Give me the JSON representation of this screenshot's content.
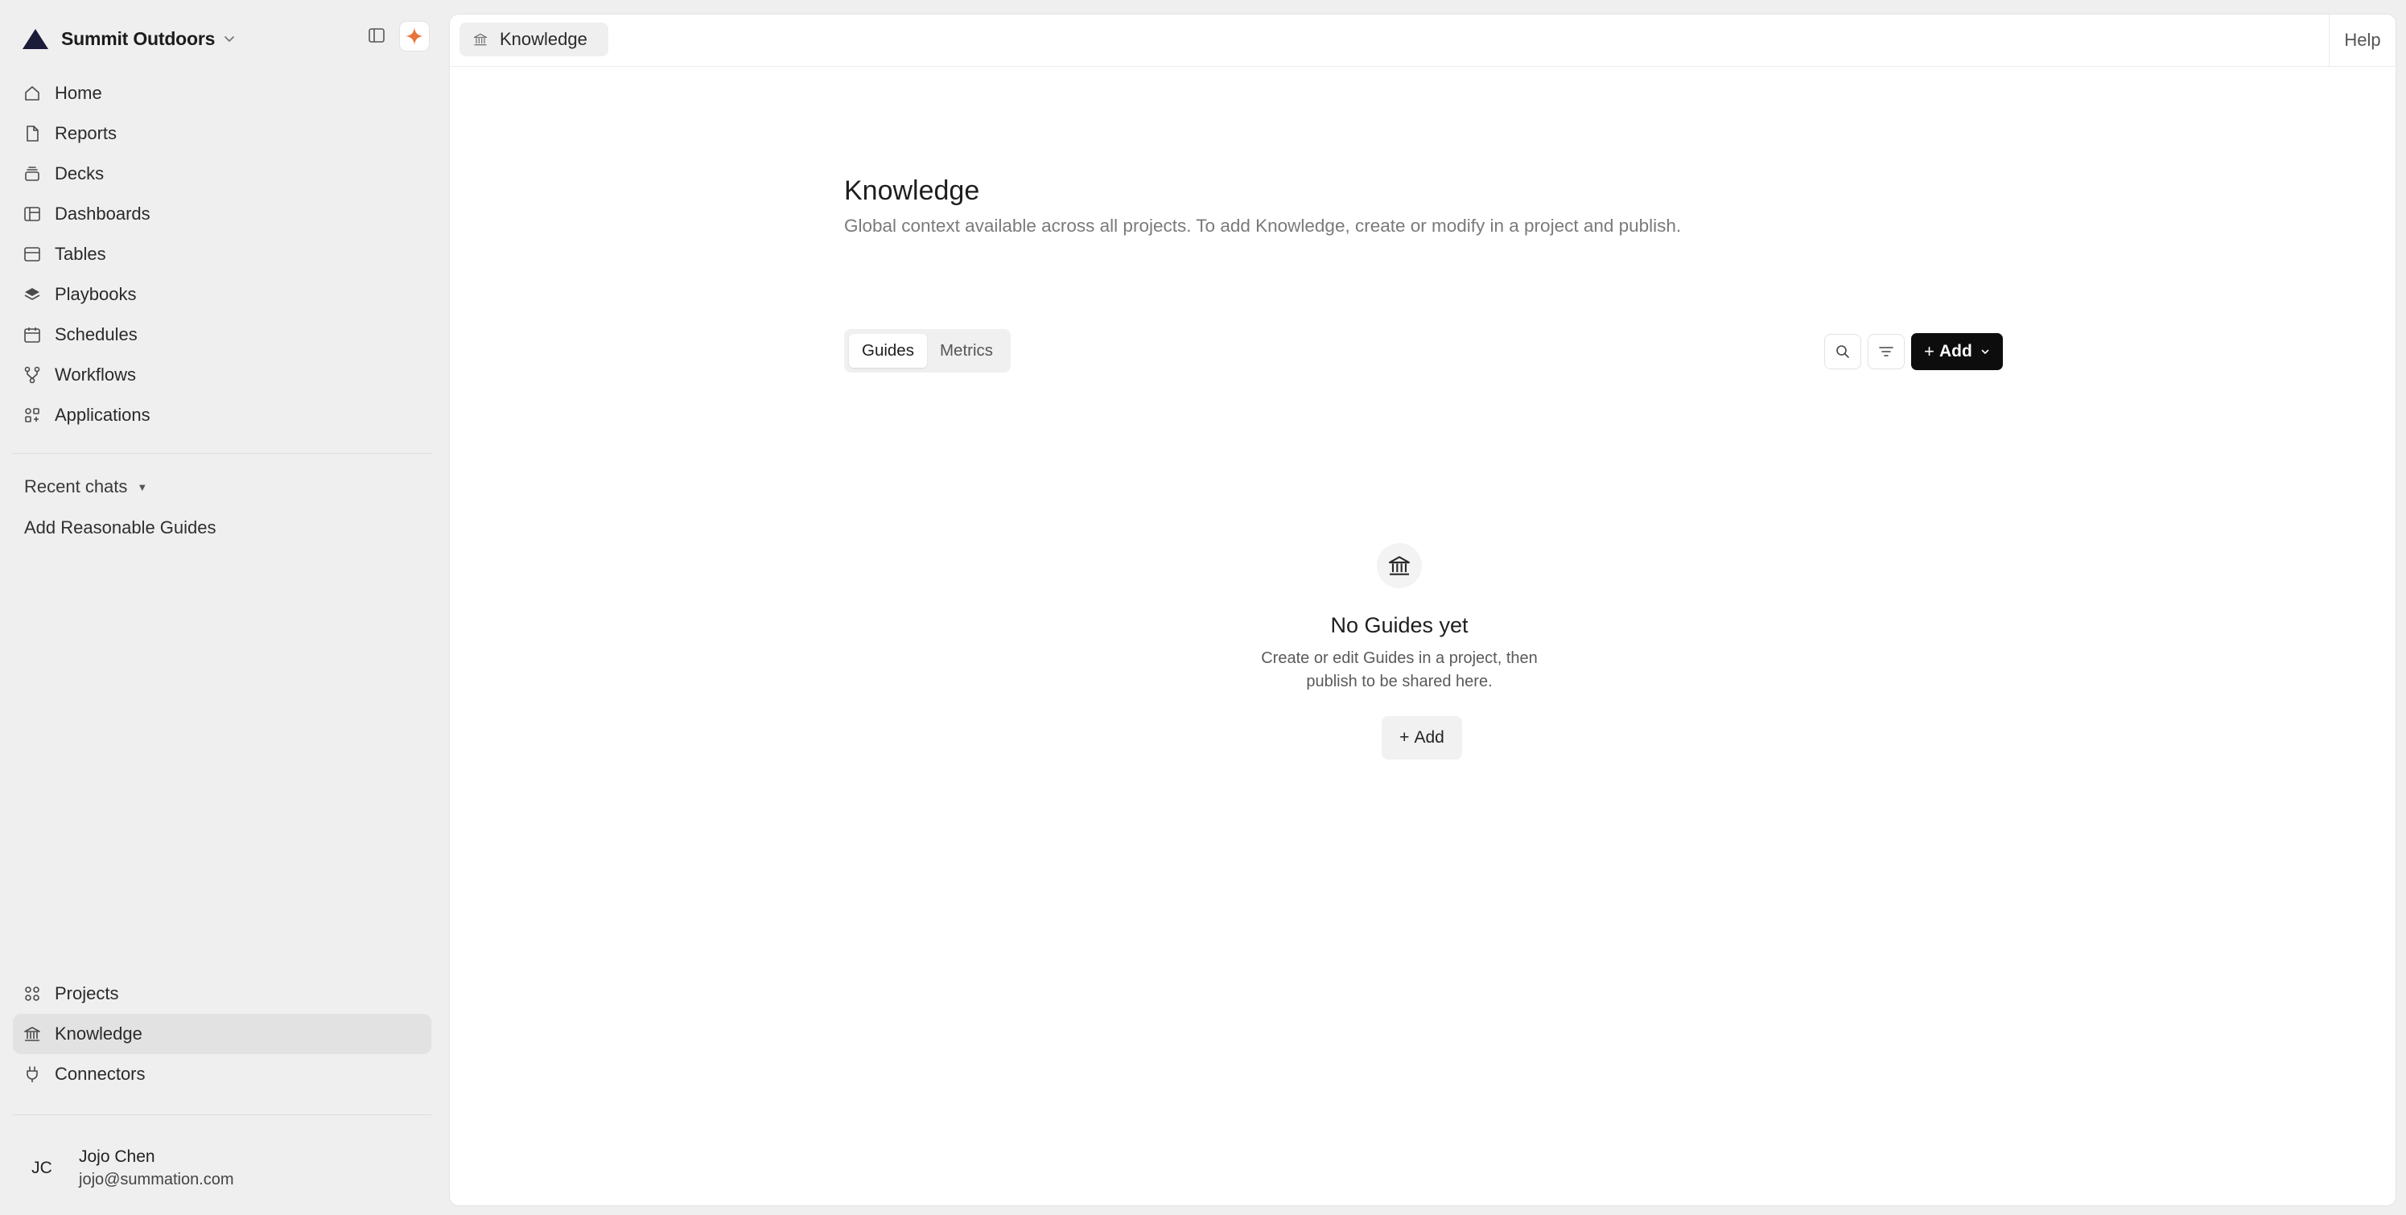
{
  "brand": {
    "name": "Summit Outdoors"
  },
  "sidebar": {
    "nav": [
      {
        "label": "Home",
        "icon": "home-icon"
      },
      {
        "label": "Reports",
        "icon": "file-icon"
      },
      {
        "label": "Decks",
        "icon": "stack-icon"
      },
      {
        "label": "Dashboards",
        "icon": "layout-icon"
      },
      {
        "label": "Tables",
        "icon": "table-icon"
      },
      {
        "label": "Playbooks",
        "icon": "layers-icon"
      },
      {
        "label": "Schedules",
        "icon": "calendar-icon"
      },
      {
        "label": "Workflows",
        "icon": "workflow-icon"
      },
      {
        "label": "Applications",
        "icon": "apps-icon"
      }
    ],
    "recent_title": "Recent chats",
    "recent_items": [
      "Add Reasonable Guides"
    ],
    "bottom_nav": [
      {
        "label": "Projects",
        "icon": "grid-icon"
      },
      {
        "label": "Knowledge",
        "icon": "bank-icon",
        "active": true
      },
      {
        "label": "Connectors",
        "icon": "plug-icon"
      }
    ],
    "user": {
      "initials": "JC",
      "name": "Jojo Chen",
      "email": "jojo@summation.com"
    }
  },
  "topbar": {
    "breadcrumb": "Knowledge",
    "help": "Help"
  },
  "page": {
    "title": "Knowledge",
    "subtitle": "Global context available across all projects. To add Knowledge, create or modify in a project and publish.",
    "tabs": [
      {
        "label": "Guides",
        "active": true
      },
      {
        "label": "Metrics",
        "active": false
      }
    ],
    "add_label": "Add"
  },
  "empty": {
    "title": "No Guides yet",
    "desc_line1": "Create or edit Guides in a project, then",
    "desc_line2": "publish to be shared here.",
    "add_label": "Add"
  },
  "colors": {
    "accent": "#e8743b",
    "primary_button": "#0d0d0d",
    "active_nav": "#e2e2e2"
  }
}
